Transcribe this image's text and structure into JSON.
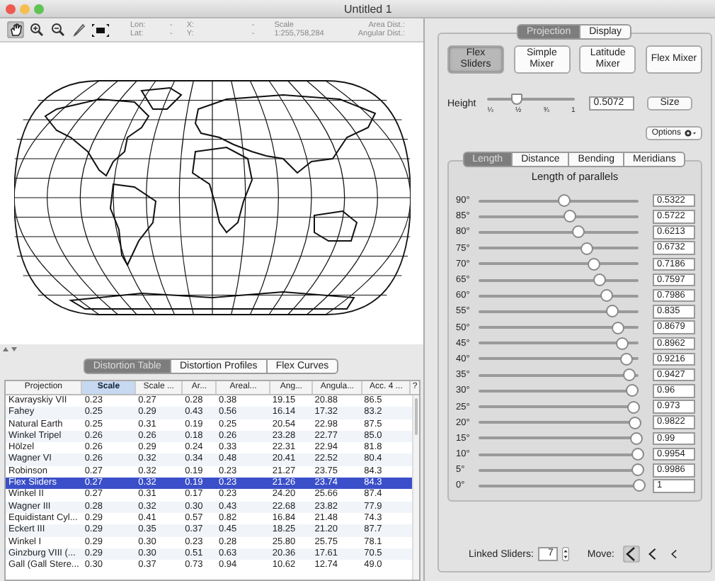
{
  "window": {
    "title": "Untitled 1"
  },
  "toolbar": {
    "tools": [
      {
        "kind": "hand",
        "selected": true
      },
      {
        "kind": "zoom_in",
        "selected": false
      },
      {
        "kind": "zoom_out",
        "selected": false
      },
      {
        "kind": "measure",
        "selected": false
      },
      {
        "kind": "fit",
        "selected": false
      }
    ],
    "coords": [
      {
        "label": "Lon:",
        "value": "-"
      },
      {
        "label": "Lat:",
        "value": "-"
      }
    ],
    "xy": [
      {
        "label": "X:",
        "value": "-"
      },
      {
        "label": "Y:",
        "value": "-"
      }
    ],
    "scale": {
      "label": "Scale",
      "value": "1:255,758,284"
    },
    "distances": [
      "Area Dist.:",
      "Angular Dist.:"
    ]
  },
  "bottom_tabs": [
    {
      "label": "Distortion Table",
      "selected": true
    },
    {
      "label": "Distortion Profiles",
      "selected": false
    },
    {
      "label": "Flex Curves",
      "selected": false
    }
  ],
  "table": {
    "columns": [
      {
        "label": "Projection",
        "selected": false
      },
      {
        "label": "Scale",
        "selected": true
      },
      {
        "label": "Scale ...",
        "selected": false
      },
      {
        "label": "Ar...",
        "selected": false
      },
      {
        "label": "Areal...",
        "selected": false
      },
      {
        "label": "Ang...",
        "selected": false
      },
      {
        "label": "Angula...",
        "selected": false
      },
      {
        "label": "Acc. 4 ...",
        "selected": false
      },
      {
        "label": "?",
        "selected": false
      }
    ],
    "rows": [
      {
        "selected": false,
        "cells": [
          "Kavrayskiy VII",
          "0.23",
          "0.27",
          "0.28",
          "0.38",
          "19.15",
          "20.88",
          "86.5"
        ]
      },
      {
        "selected": false,
        "cells": [
          "Fahey",
          "0.25",
          "0.29",
          "0.43",
          "0.56",
          "16.14",
          "17.32",
          "83.2"
        ]
      },
      {
        "selected": false,
        "cells": [
          "Natural Earth",
          "0.25",
          "0.31",
          "0.19",
          "0.25",
          "20.54",
          "22.98",
          "87.5"
        ]
      },
      {
        "selected": false,
        "cells": [
          "Winkel Tripel",
          "0.26",
          "0.26",
          "0.18",
          "0.26",
          "23.28",
          "22.77",
          "85.0"
        ]
      },
      {
        "selected": false,
        "cells": [
          "Hölzel",
          "0.26",
          "0.29",
          "0.24",
          "0.33",
          "22.31",
          "22.94",
          "81.8"
        ]
      },
      {
        "selected": false,
        "cells": [
          "Wagner VI",
          "0.26",
          "0.32",
          "0.34",
          "0.48",
          "20.41",
          "22.52",
          "80.4"
        ]
      },
      {
        "selected": false,
        "cells": [
          "Robinson",
          "0.27",
          "0.32",
          "0.19",
          "0.23",
          "21.27",
          "23.75",
          "84.3"
        ]
      },
      {
        "selected": true,
        "cells": [
          "Flex Sliders",
          "0.27",
          "0.32",
          "0.19",
          "0.23",
          "21.26",
          "23.74",
          "84.3"
        ]
      },
      {
        "selected": false,
        "cells": [
          "Winkel II",
          "0.27",
          "0.31",
          "0.17",
          "0.23",
          "24.20",
          "25.66",
          "87.4"
        ]
      },
      {
        "selected": false,
        "cells": [
          "Wagner III",
          "0.28",
          "0.32",
          "0.30",
          "0.43",
          "22.68",
          "23.82",
          "77.9"
        ]
      },
      {
        "selected": false,
        "cells": [
          "Equidistant Cyl...",
          "0.29",
          "0.41",
          "0.57",
          "0.82",
          "16.84",
          "21.48",
          "74.3"
        ]
      },
      {
        "selected": false,
        "cells": [
          "Eckert III",
          "0.29",
          "0.35",
          "0.37",
          "0.45",
          "18.25",
          "21.20",
          "87.7"
        ]
      },
      {
        "selected": false,
        "cells": [
          "Winkel I",
          "0.29",
          "0.30",
          "0.23",
          "0.28",
          "25.80",
          "25.75",
          "78.1"
        ]
      },
      {
        "selected": false,
        "cells": [
          "Ginzburg VIII (...",
          "0.29",
          "0.30",
          "0.51",
          "0.63",
          "20.36",
          "17.61",
          "70.5"
        ]
      },
      {
        "selected": false,
        "cells": [
          "Gall (Gall Stere...",
          "0.30",
          "0.37",
          "0.73",
          "0.94",
          "10.62",
          "12.74",
          "49.0"
        ]
      }
    ]
  },
  "panel_tabs": [
    {
      "label": "Projection",
      "selected": true
    },
    {
      "label": "Display",
      "selected": false
    }
  ],
  "mode_buttons": [
    {
      "label": "Flex Sliders",
      "selected": true
    },
    {
      "label": "Simple Mixer",
      "selected": false
    },
    {
      "label": "Latitude Mixer",
      "selected": false
    },
    {
      "label": "Flex Mixer",
      "selected": false
    }
  ],
  "height": {
    "label": "Height",
    "level": 0.34,
    "ticks": [
      "¼",
      "½",
      "¾",
      "1"
    ],
    "value": "0.5072",
    "button": "Size"
  },
  "options_button": "Options",
  "sub_tabs": [
    {
      "label": "Length",
      "selected": true
    },
    {
      "label": "Distance",
      "selected": false
    },
    {
      "label": "Bending",
      "selected": false
    },
    {
      "label": "Meridians",
      "selected": false
    }
  ],
  "group_title": "Length of parallels",
  "parallels": [
    {
      "label": "90°",
      "level": 0.5322,
      "value": "0.5322"
    },
    {
      "label": "85°",
      "level": 0.5722,
      "value": "0.5722"
    },
    {
      "label": "80°",
      "level": 0.6213,
      "value": "0.6213"
    },
    {
      "label": "75°",
      "level": 0.6732,
      "value": "0.6732"
    },
    {
      "label": "70°",
      "level": 0.7186,
      "value": "0.7186"
    },
    {
      "label": "65°",
      "level": 0.7597,
      "value": "0.7597"
    },
    {
      "label": "60°",
      "level": 0.7986,
      "value": "0.7986"
    },
    {
      "label": "55°",
      "level": 0.835,
      "value": "0.835"
    },
    {
      "label": "50°",
      "level": 0.8679,
      "value": "0.8679"
    },
    {
      "label": "45°",
      "level": 0.8962,
      "value": "0.8962"
    },
    {
      "label": "40°",
      "level": 0.9216,
      "value": "0.9216"
    },
    {
      "label": "35°",
      "level": 0.9427,
      "value": "0.9427"
    },
    {
      "label": "30°",
      "level": 0.96,
      "value": "0.96"
    },
    {
      "label": "25°",
      "level": 0.973,
      "value": "0.973"
    },
    {
      "label": "20°",
      "level": 0.9822,
      "value": "0.9822"
    },
    {
      "label": "15°",
      "level": 0.99,
      "value": "0.99"
    },
    {
      "label": "10°",
      "level": 0.9954,
      "value": "0.9954"
    },
    {
      "label": "5°",
      "level": 0.9986,
      "value": "0.9986"
    },
    {
      "label": "0°",
      "level": 1,
      "value": "1"
    }
  ],
  "linked": {
    "label": "Linked Sliders:",
    "value": "7"
  },
  "move": {
    "label": "Move:",
    "buttons": [
      {
        "kind": "large",
        "selected": true
      },
      {
        "kind": "medium",
        "selected": false
      },
      {
        "kind": "small",
        "selected": false
      }
    ]
  }
}
